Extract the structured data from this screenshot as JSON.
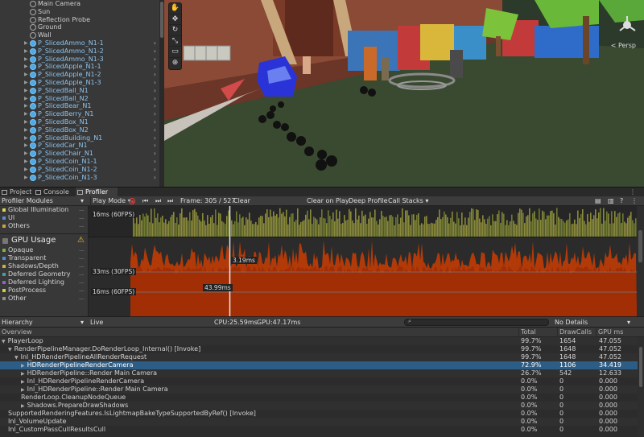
{
  "hierarchy": {
    "items": [
      {
        "label": "Main Camera",
        "prefab": false,
        "arrow": false
      },
      {
        "label": "Sun",
        "prefab": false,
        "arrow": false
      },
      {
        "label": "Reflection Probe",
        "prefab": false,
        "arrow": false
      },
      {
        "label": "Ground",
        "prefab": false,
        "arrow": false
      },
      {
        "label": "Wall",
        "prefab": false,
        "arrow": false
      },
      {
        "label": "P_SlicedAmmo_N1-1",
        "prefab": true,
        "arrow": true
      },
      {
        "label": "P_SlicedAmmo_N1-2",
        "prefab": true,
        "arrow": true
      },
      {
        "label": "P_SlicedAmmo_N1-3",
        "prefab": true,
        "arrow": true
      },
      {
        "label": "P_SlicedApple_N1-1",
        "prefab": true,
        "arrow": true
      },
      {
        "label": "P_SlicedApple_N1-2",
        "prefab": true,
        "arrow": true
      },
      {
        "label": "P_SlicedApple_N1-3",
        "prefab": true,
        "arrow": true
      },
      {
        "label": "P_SlicedBall_N1",
        "prefab": true,
        "arrow": true
      },
      {
        "label": "P_SlicedBall_N2",
        "prefab": true,
        "arrow": true
      },
      {
        "label": "P_SlicedBear_N1",
        "prefab": true,
        "arrow": true
      },
      {
        "label": "P_SlicedBerry_N1",
        "prefab": true,
        "arrow": true
      },
      {
        "label": "P_SlicedBox_N1",
        "prefab": true,
        "arrow": true
      },
      {
        "label": "P_SlicedBox_N2",
        "prefab": true,
        "arrow": true
      },
      {
        "label": "P_SlicedBuilding_N1",
        "prefab": true,
        "arrow": true
      },
      {
        "label": "P_SlicedCar_N1",
        "prefab": true,
        "arrow": true
      },
      {
        "label": "P_SlicedChair_N1",
        "prefab": true,
        "arrow": true
      },
      {
        "label": "P_SlicedCoin_N1-1",
        "prefab": true,
        "arrow": true
      },
      {
        "label": "P_SlicedCoin_N1-2",
        "prefab": true,
        "arrow": true
      },
      {
        "label": "P_SlicedCoin_N1-3",
        "prefab": true,
        "arrow": true
      }
    ]
  },
  "scene": {
    "persp_label": "< Persp"
  },
  "tabs": {
    "project": "Project",
    "console": "Console",
    "profiler": "Profiler"
  },
  "profiler_toolbar": {
    "modules_label": "Profiler Modules",
    "play_mode": "Play Mode",
    "frame": "Frame: 305 / 527",
    "clear": "Clear",
    "clear_on_play": "Clear on Play",
    "deep_profile": "Deep Profile",
    "call_stacks": "Call Stacks"
  },
  "modules": {
    "top": [
      {
        "label": "Global Illumination",
        "color": "#d9d94a"
      },
      {
        "label": "UI",
        "color": "#5a8ad8"
      },
      {
        "label": "Others",
        "color": "#c7a83a"
      }
    ],
    "gpu_title": "GPU Usage",
    "gpu_items": [
      {
        "label": "Opaque",
        "color": "#7db33b"
      },
      {
        "label": "Transparent",
        "color": "#4a90d9"
      },
      {
        "label": "Shadows/Depth",
        "color": "#c9b43a"
      },
      {
        "label": "Deferred Geometry",
        "color": "#3aa5a5"
      },
      {
        "label": "Deferred Lighting",
        "color": "#9a5ec8"
      },
      {
        "label": "PostProcess",
        "color": "#d0d03a"
      },
      {
        "label": "Other",
        "color": "#909090"
      }
    ]
  },
  "charts": {
    "top_label": "16ms (60FPS)",
    "gpu_label_33": "33ms (30FPS)",
    "gpu_label_16": "16ms (60FPS)",
    "readout_1": "3.19ms",
    "readout_2": "43.99ms"
  },
  "hier_bar": {
    "view": "Hierarchy",
    "live": "Live",
    "cpu": "CPU:25.59ms",
    "gpu": "GPU:47.17ms",
    "details": "No Details"
  },
  "table": {
    "headers": {
      "overview": "Overview",
      "total": "Total",
      "drawcalls": "DrawCalls",
      "gpums": "GPU ms"
    },
    "rows": [
      {
        "name": "PlayerLoop",
        "indent": 0,
        "arrow": "▼",
        "total": "99.7%",
        "drawcalls": "1654",
        "gpums": "47.055",
        "sel": false
      },
      {
        "name": "RenderPipelineManager.DoRenderLoop_Internal() [Invoke]",
        "indent": 1,
        "arrow": "▼",
        "total": "99.7%",
        "drawcalls": "1648",
        "gpums": "47.052",
        "sel": false
      },
      {
        "name": "Inl_HDRenderPipelineAllRenderRequest",
        "indent": 2,
        "arrow": "▼",
        "total": "99.7%",
        "drawcalls": "1648",
        "gpums": "47.052",
        "sel": false
      },
      {
        "name": "HDRenderPipelineRenderCamera",
        "indent": 3,
        "arrow": "▶",
        "total": "72.9%",
        "drawcalls": "1106",
        "gpums": "34.419",
        "sel": true
      },
      {
        "name": "HDRenderPipeline::Render Main Camera",
        "indent": 3,
        "arrow": "▶",
        "total": "26.7%",
        "drawcalls": "542",
        "gpums": "12.633",
        "sel": false
      },
      {
        "name": "Inl_HDRenderPipelineRenderCamera",
        "indent": 3,
        "arrow": "▶",
        "total": "0.0%",
        "drawcalls": "0",
        "gpums": "0.000",
        "sel": false
      },
      {
        "name": "Inl_HDRenderPipeline::Render Main Camera",
        "indent": 3,
        "arrow": "▶",
        "total": "0.0%",
        "drawcalls": "0",
        "gpums": "0.000",
        "sel": false
      },
      {
        "name": "RenderLoop.CleanupNodeQueue",
        "indent": 3,
        "arrow": "",
        "total": "0.0%",
        "drawcalls": "0",
        "gpums": "0.000",
        "sel": false
      },
      {
        "name": "Shadows.PrepareDrawShadows",
        "indent": 3,
        "arrow": "▶",
        "total": "0.0%",
        "drawcalls": "0",
        "gpums": "0.000",
        "sel": false
      },
      {
        "name": "SupportedRenderingFeatures.IsLightmapBakeTypeSupportedByRef() [Invoke]",
        "indent": 1,
        "arrow": "",
        "total": "0.0%",
        "drawcalls": "0",
        "gpums": "0.000",
        "sel": false
      },
      {
        "name": "Inl_VolumeUpdate",
        "indent": 1,
        "arrow": "",
        "total": "0.0%",
        "drawcalls": "0",
        "gpums": "0.000",
        "sel": false
      },
      {
        "name": "Inl_CustomPassCullResultsCull",
        "indent": 1,
        "arrow": "",
        "total": "0.0%",
        "drawcalls": "0",
        "gpums": "0.000",
        "sel": false
      }
    ]
  }
}
